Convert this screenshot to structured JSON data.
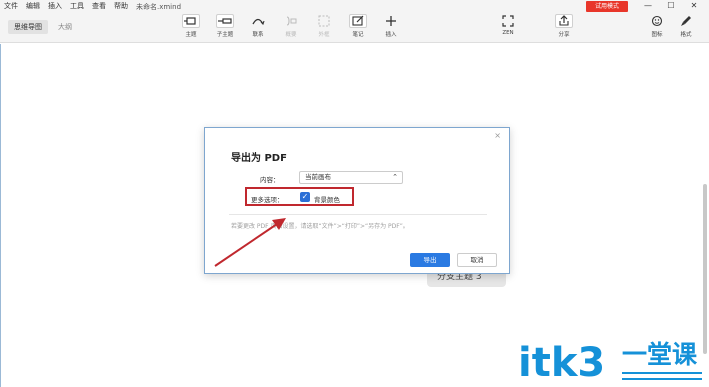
{
  "menubar": {
    "items": [
      "文件",
      "编辑",
      "插入",
      "工具",
      "查看",
      "帮助"
    ],
    "filename": "未命名.xmind",
    "trial_badge": "试用模式",
    "window_controls": {
      "minimize": "—",
      "maximize": "☐",
      "close": "✕"
    }
  },
  "toolbar": {
    "view_tabs": [
      "思维导图",
      "大纲"
    ],
    "tools": {
      "topic": "主题",
      "subtopic": "子主题",
      "relationship": "联系",
      "summary": "概要",
      "boundary": "外框",
      "note": "笔记",
      "insert": "插入",
      "zen": "ZEN",
      "share": "分享",
      "icon": "图标",
      "format": "格式"
    }
  },
  "canvas": {
    "topic_node": "分支主题 3"
  },
  "dialog": {
    "close": "×",
    "title": "导出为 PDF",
    "content_label": "内容：",
    "content_value": "当前画布",
    "options_label": "更多选项：",
    "background_checkbox_label": "背景颜色",
    "hint": "若要更改 PDF 页面设置，请选取“文件”>“打印”>“另存为 PDF”。",
    "export_button": "导出",
    "cancel_button": "取消"
  },
  "watermark": "itk3 一堂课",
  "colors": {
    "trial_badge": "#e8362a",
    "primary_button": "#2a7ae2",
    "highlight_box": "#c0282e",
    "checkbox": "#2a6fd6",
    "watermark": "#1591d8"
  }
}
